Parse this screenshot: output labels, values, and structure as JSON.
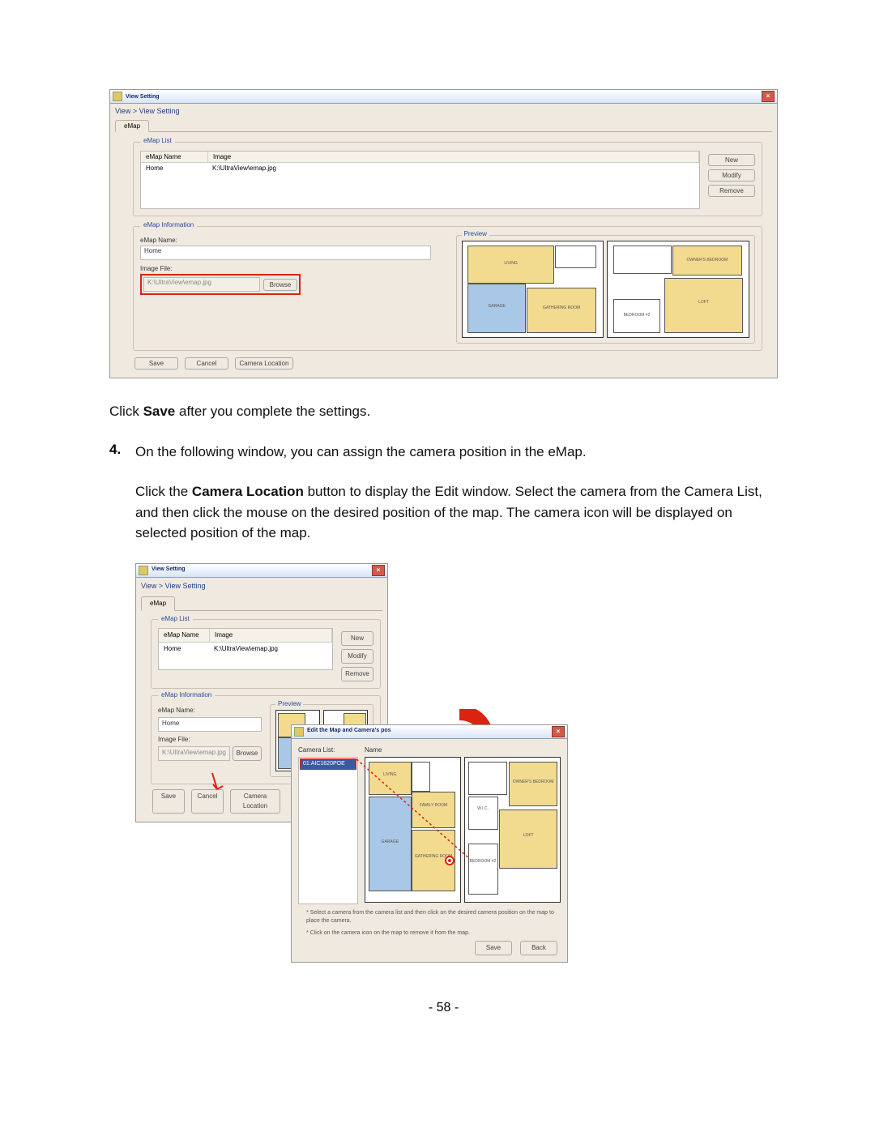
{
  "fig1": {
    "title": "View Setting",
    "breadcrumb": "View > View Setting",
    "tab": "eMap",
    "list_legend": "eMap List",
    "col_name": "eMap Name",
    "col_image": "Image",
    "row_name": "Home",
    "row_image": "K:\\UltraView\\emap.jpg",
    "btn_new": "New",
    "btn_modify": "Modify",
    "btn_remove": "Remove",
    "info_legend": "eMap Information",
    "lbl_emap_name": "eMap Name:",
    "val_emap_name": "Home",
    "lbl_image_file": "Image File:",
    "val_image_file": "K:\\UltraView\\emap.jpg",
    "btn_browse": "Browse",
    "preview_legend": "Preview",
    "btn_save": "Save",
    "btn_cancel": "Cancel",
    "btn_camloc": "Camera Location"
  },
  "txt": {
    "click_save_pre": "Click ",
    "click_save_bold": "Save",
    "click_save_post": " after you complete the settings.",
    "step_num": "4.",
    "step_line1": "On the following window, you can assign the camera position in the eMap.",
    "step_line2a": "Click the ",
    "step_line2b": "Camera Location",
    "step_line2c": " button to display the Edit window. Select the camera from the Camera List, and then click the mouse on the desired position of the map. The camera icon will be displayed on selected position of the map."
  },
  "fig2b": {
    "title": "Edit the Map and Camera's pos",
    "lbl_camera_list": "Camera List:",
    "camera_item": "01:AIC1620POE",
    "note1": "* Select a camera from the camera list and then click on the desired camera position on the map to place the camera.",
    "note2": "* Click on the camera icon on the map to remove it from the map.",
    "btn_save": "Save",
    "btn_back": "Back",
    "col_name": "Name"
  },
  "rooms": {
    "living": "LIVING",
    "garage": "GARAGE",
    "gathering": "GATHERING ROOM",
    "family": "FAMILY ROOM",
    "owners": "OWNER'S BEDROOM",
    "loft": "LOFT",
    "bedroom2": "BEDROOM #2",
    "wic": "W.I.C."
  },
  "page_number": "- 58 -"
}
